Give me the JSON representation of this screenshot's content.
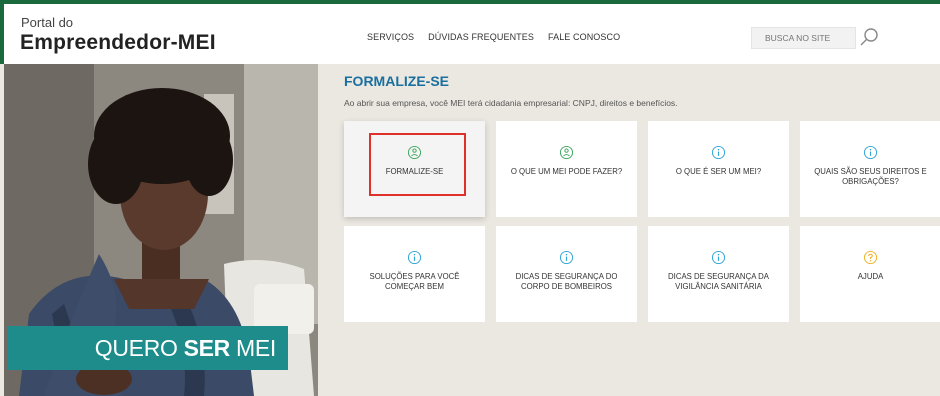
{
  "header": {
    "logo_small": "Portal do",
    "logo_big": "Empreendedor-MEI",
    "nav": [
      "SERVIÇOS",
      "DÚVIDAS FREQUENTES",
      "FALE CONOSCO"
    ],
    "search_placeholder": "BUSCA NO SITE",
    "search_icon": "magnifier-icon"
  },
  "hero": {
    "cta_pre": "QUERO",
    "cta_bold": "SER",
    "cta_post": "MEI"
  },
  "section": {
    "title": "FORMALIZE-SE",
    "subtitle": "Ao abrir sua empresa, você MEI terá cidadania empresarial: CNPJ, direitos e benefícios."
  },
  "cards": [
    {
      "label": "FORMALIZE-SE",
      "icon": "person-icon",
      "color": "#3aa55a",
      "selected": true
    },
    {
      "label": "O QUE UM MEI PODE FAZER?",
      "icon": "person-icon",
      "color": "#3aa55a"
    },
    {
      "label": "O QUE É SER UM MEI?",
      "icon": "info-icon",
      "color": "#2aa3d6"
    },
    {
      "label": "QUAIS SÃO SEUS DIREITOS E OBRIGAÇÕES?",
      "icon": "info-icon",
      "color": "#2aa3d6"
    },
    {
      "label": "SOLUÇÕES PARA VOCÊ COMEÇAR BEM",
      "icon": "info-icon",
      "color": "#2aa3d6"
    },
    {
      "label": "DICAS DE SEGURANÇA DO CORPO DE BOMBEIROS",
      "icon": "info-icon",
      "color": "#2aa3d6"
    },
    {
      "label": "DICAS DE SEGURANÇA DA VIGILÂNCIA SANITÁRIA",
      "icon": "info-icon",
      "color": "#2aa3d6"
    },
    {
      "label": "AJUDA",
      "icon": "help-icon",
      "color": "#f0b020"
    }
  ]
}
